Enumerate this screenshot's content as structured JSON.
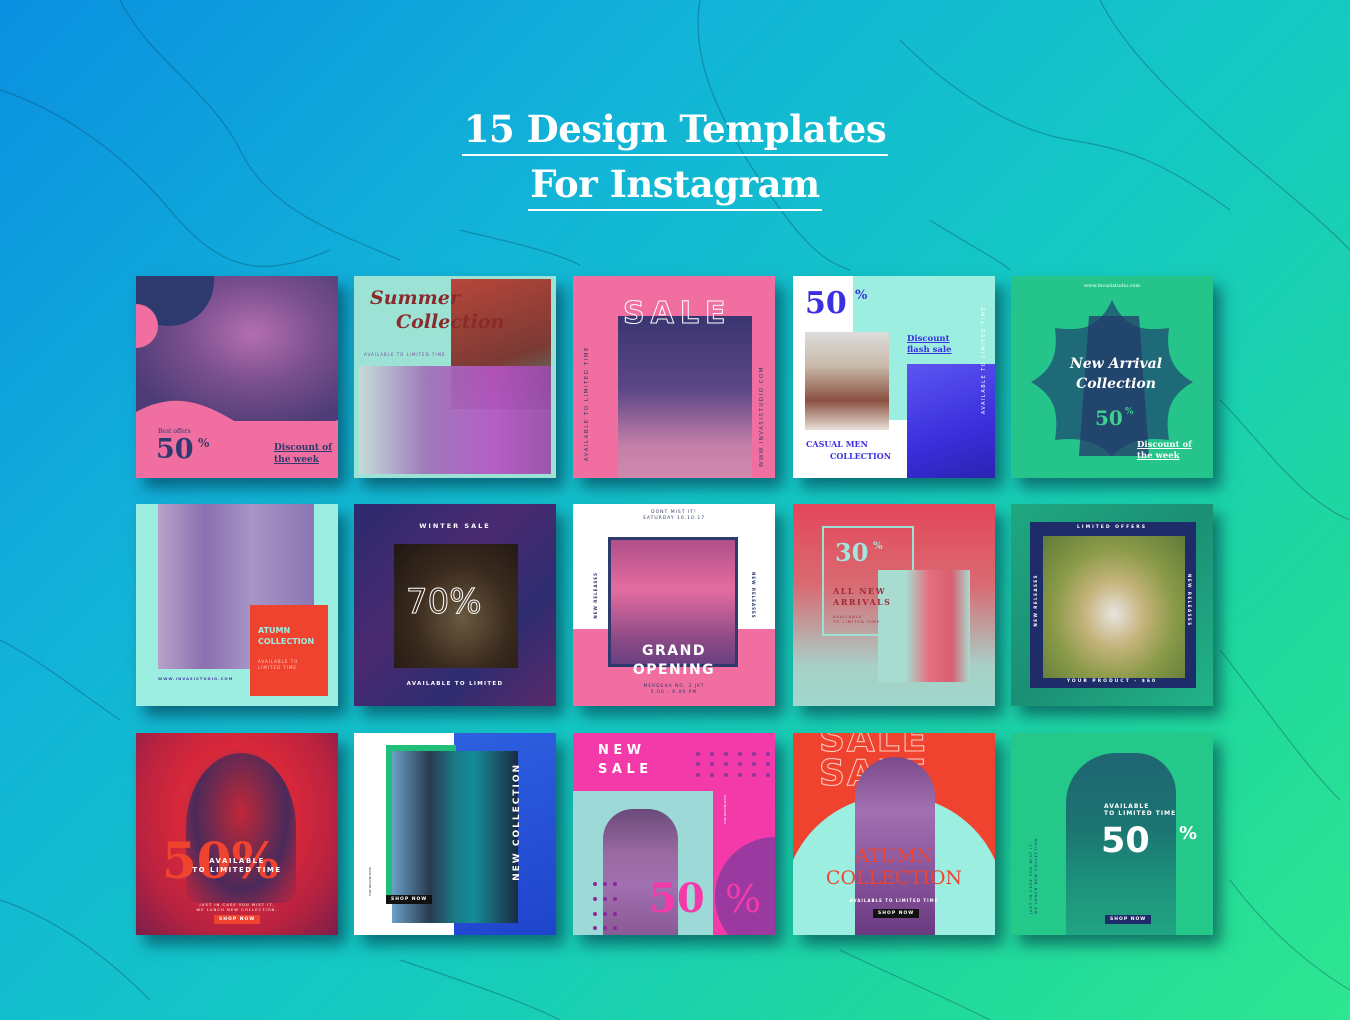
{
  "title": {
    "line1": "15 Design Templates",
    "line2": "For Instagram"
  },
  "colors": {
    "bg_start": "#0a8fe0",
    "bg_end": "#2ee690",
    "pink": "#f06fa0",
    "navy": "#2e3a6e",
    "mint": "#9ce8dc",
    "coral": "#f0432f",
    "green": "#24c48a",
    "blue": "#3b2fe0",
    "magenta": "#f13aa8"
  },
  "templates": [
    {
      "id": 1,
      "small": "Best offers",
      "percent": "50",
      "percent_sign": "%",
      "tagline1": "Discount of",
      "tagline2": "the week"
    },
    {
      "id": 2,
      "script1": "Summer",
      "script2": "Collection",
      "sub": "AVAILABLE TO LIMITED TIME"
    },
    {
      "id": 3,
      "headline": "SALE",
      "left_vertical": "AVAILABLE TO LIMITED TIME",
      "right_vertical": "WWW.INVASISTUDIO.COM"
    },
    {
      "id": 4,
      "percent": "50",
      "percent_sign": "%",
      "discount1": "Discount",
      "discount2": "flash sale",
      "vertical": "AVAILABLE TO LIMITED TIME",
      "collection1": "CASUAL MEN",
      "collection2": "COLLECTION"
    },
    {
      "id": 5,
      "url": "www.invasistudio.com",
      "script1": "New Arrival",
      "script2": "Collection",
      "percent": "50",
      "percent_sign": "%",
      "tagline1": "Discount of",
      "tagline2": "the week"
    },
    {
      "id": 6,
      "heading1": "ATUMN",
      "heading2": "COLLECTION",
      "sub1": "AVAILABLE TO",
      "sub2": "LIMITED TIME",
      "url": "WWW.INVASISTUDIO.COM"
    },
    {
      "id": 7,
      "top": "WINTER SALE",
      "percent": "70%",
      "bottom": "AVAILABLE TO LIMITED"
    },
    {
      "id": 8,
      "top1": "DONT MIST IT!",
      "top2": "SATURDAY 10.10.17",
      "side_left": "NEW RELEASES",
      "side_right": "NEW RELEASES",
      "heading1": "GRAND",
      "heading2": "OPENING",
      "addr1": "MERDEKA NO. 3 JKT",
      "addr2": "5.00 - 8.00 PM"
    },
    {
      "id": 9,
      "percent": "30",
      "percent_sign": "%",
      "heading1": "ALL NEW",
      "heading2": "ARRIVALS",
      "sub1": "AVAILABLE",
      "sub2": "TO LIMITED TIME"
    },
    {
      "id": 10,
      "top": "LIMITED OFFERS",
      "side_left": "NEW RELEASES",
      "side_right": "NEW RELEASES",
      "bottom": "YOUR PRODUCT - $60"
    },
    {
      "id": 11,
      "percent": "50%",
      "overlay1": "AVAILABLE",
      "overlay2": "TO LIMITED TIME",
      "sub1": "JUST IN CASE YOU MIST IT.",
      "sub2": "WE LUNCH NEW COLLECTION.",
      "button": "SHOP NOW"
    },
    {
      "id": 12,
      "vertical": "NEW COLLECTION",
      "small1": "SLICK BLOUSE",
      "small2": "80%",
      "button": "SHOP NOW"
    },
    {
      "id": 13,
      "heading1": "N E W",
      "heading2": "S A L E",
      "small1": "SLICK BLOUSE",
      "small2": "80%",
      "percent": "50",
      "percent_sign": "%"
    },
    {
      "id": 14,
      "bg_word": "SALE",
      "heading1": "ATUMN",
      "heading2": "COLLECTION",
      "sub": "AVAILABLE TO LIMITED TIME",
      "button": "SHOP NOW"
    },
    {
      "id": 15,
      "overlay1": "AVAILABLE",
      "overlay2": "TO LIMITED TIME",
      "percent": "50",
      "percent_sign": "%",
      "vertical1": "JUST IN CASE YOU MIST IT,",
      "vertical2": "WE LUNCH NEW COLLECTION",
      "button": "SHOP NOW"
    }
  ]
}
